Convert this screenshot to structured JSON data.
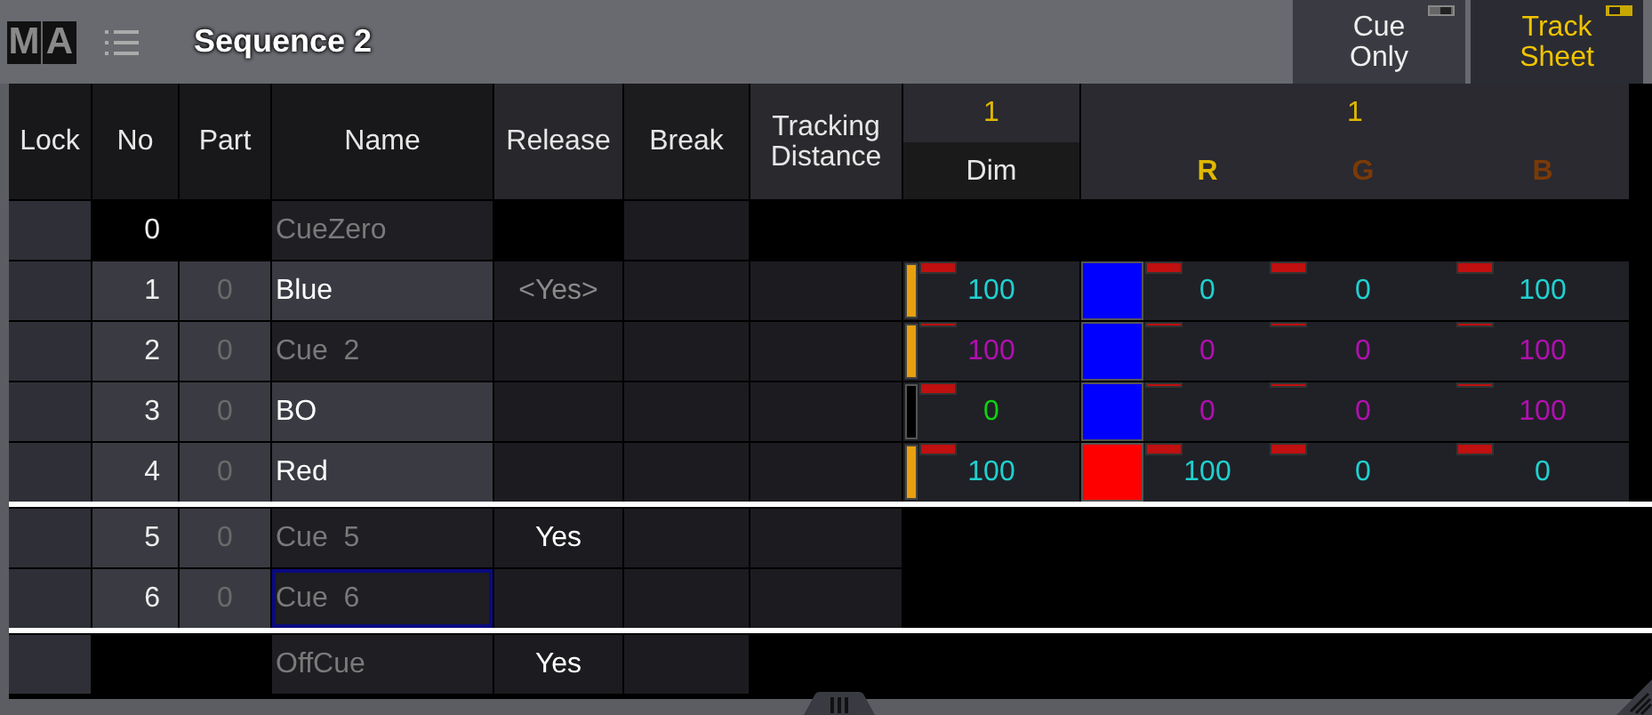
{
  "logo": [
    "M",
    "A"
  ],
  "title": "Sequence 2",
  "mode_buttons": [
    {
      "label": "Cue Only",
      "on": false
    },
    {
      "label": "Track Sheet",
      "on": true
    }
  ],
  "columns": [
    "Lock",
    "No",
    "Part",
    "Name",
    "Release",
    "Break",
    "Tracking Distance"
  ],
  "fixture_header": {
    "dim_fixture": "1",
    "dim_label": "Dim",
    "rgb_fixture": "1",
    "rgb_labels": [
      {
        "label": "R",
        "color": "#e0b800"
      },
      {
        "label": "G",
        "color": "#7a3a08"
      },
      {
        "label": "B",
        "color": "#7a3a08"
      }
    ]
  },
  "rows": [
    {
      "kind": "zero",
      "no": "0",
      "name": "CueZero",
      "default_name": true,
      "selected": false,
      "separator_below": false
    },
    {
      "kind": "cue",
      "no": "1",
      "part": "0",
      "name": "Blue",
      "default_name": false,
      "selected": false,
      "release": "<Yes>",
      "release_inherited": true,
      "separator_below": false,
      "dim": {
        "level": 1,
        "value": "100",
        "color": "#20d0d0",
        "flag_strong": true
      },
      "swatch": {
        "color": "#0000ff"
      },
      "rgb": [
        {
          "value": "0",
          "color": "#20d0d0",
          "flag_strong": true
        },
        {
          "value": "0",
          "color": "#20d0d0",
          "flag_strong": true
        },
        {
          "value": "100",
          "color": "#20d0d0",
          "flag_strong": true
        }
      ]
    },
    {
      "kind": "cue",
      "no": "2",
      "part": "0",
      "name": "Cue  2",
      "default_name": true,
      "selected": false,
      "separator_below": false,
      "dim": {
        "level": 1,
        "value": "100",
        "color": "#b010b0",
        "flag_strong": false
      },
      "swatch": {
        "color": "#0000ff"
      },
      "rgb": [
        {
          "value": "0",
          "color": "#b010b0",
          "flag_strong": false
        },
        {
          "value": "0",
          "color": "#b010b0",
          "flag_strong": false
        },
        {
          "value": "100",
          "color": "#b010b0",
          "flag_strong": false
        }
      ]
    },
    {
      "kind": "cue",
      "no": "3",
      "part": "0",
      "name": "BO",
      "default_name": false,
      "selected": false,
      "separator_below": false,
      "dim": {
        "level": 0,
        "value": "0",
        "color": "#10d010",
        "flag_strong": true
      },
      "swatch": {
        "color": "#0000ff"
      },
      "rgb": [
        {
          "value": "0",
          "color": "#b010b0",
          "flag_strong": false
        },
        {
          "value": "0",
          "color": "#b010b0",
          "flag_strong": false
        },
        {
          "value": "100",
          "color": "#b010b0",
          "flag_strong": false
        }
      ]
    },
    {
      "kind": "cue",
      "no": "4",
      "part": "0",
      "name": "Red",
      "default_name": false,
      "selected": false,
      "separator_below": true,
      "dim": {
        "level": 1,
        "value": "100",
        "color": "#20d0d0",
        "flag_strong": true
      },
      "swatch": {
        "color": "#ff0000"
      },
      "rgb": [
        {
          "value": "100",
          "color": "#20d0d0",
          "flag_strong": true
        },
        {
          "value": "0",
          "color": "#20d0d0",
          "flag_strong": true
        },
        {
          "value": "0",
          "color": "#20d0d0",
          "flag_strong": true
        }
      ]
    },
    {
      "kind": "cue",
      "no": "5",
      "part": "0",
      "name": "Cue  5",
      "default_name": true,
      "selected": false,
      "release": "Yes",
      "release_inherited": false,
      "separator_below": false
    },
    {
      "kind": "cue",
      "no": "6",
      "part": "0",
      "name": "Cue  6",
      "default_name": true,
      "selected": true,
      "separator_below": true
    },
    {
      "kind": "off",
      "name": "OffCue",
      "default_name": true,
      "selected": false,
      "release": "Yes",
      "release_inherited": false,
      "separator_below": false
    }
  ]
}
